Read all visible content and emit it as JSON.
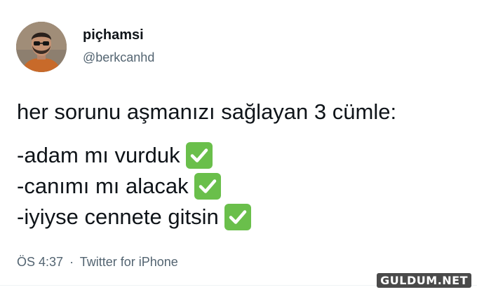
{
  "author": {
    "display_name": "piçhamsi",
    "handle": "@berkcanhd"
  },
  "tweet": {
    "intro": "her sorunu aşmanızı sağlayan 3 cümle:",
    "items": [
      {
        "text": "-adam mı vurduk",
        "icon": "check-mark-button-icon"
      },
      {
        "text": "-canımı mı alacak",
        "icon": "check-mark-button-icon"
      },
      {
        "text": "-iyiyse cennete gitsin",
        "icon": "check-mark-button-icon"
      }
    ]
  },
  "meta": {
    "time": "ÖS 4:37",
    "separator": "·",
    "source": "Twitter for iPhone"
  },
  "watermark": "GULDUM.NET",
  "colors": {
    "check_green": "#6abf4b",
    "secondary_text": "#536471",
    "primary_text": "#0f1419"
  }
}
